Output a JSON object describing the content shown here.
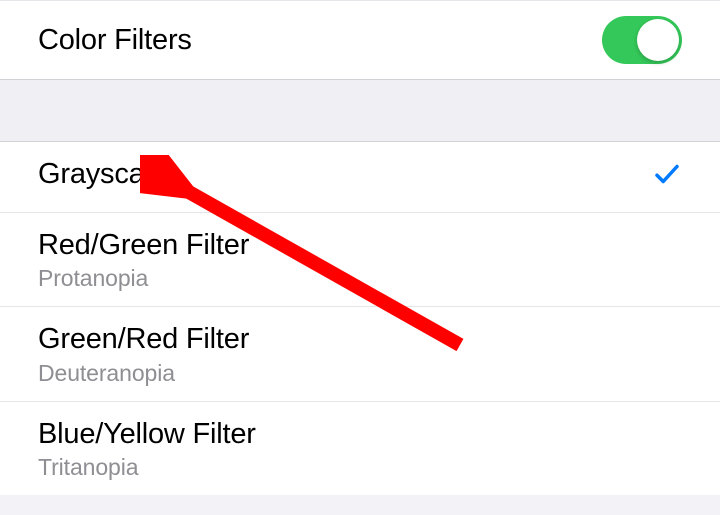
{
  "header": {
    "toggle_label": "Color Filters",
    "toggle_on": true
  },
  "filters": [
    {
      "title": "Grayscale",
      "subtitle": "",
      "selected": true
    },
    {
      "title": "Red/Green Filter",
      "subtitle": "Protanopia",
      "selected": false
    },
    {
      "title": "Green/Red Filter",
      "subtitle": "Deuteranopia",
      "selected": false
    },
    {
      "title": "Blue/Yellow Filter",
      "subtitle": "Tritanopia",
      "selected": false
    }
  ],
  "colors": {
    "toggle_on": "#34c759",
    "checkmark": "#007aff",
    "annotation": "#ff0000"
  }
}
